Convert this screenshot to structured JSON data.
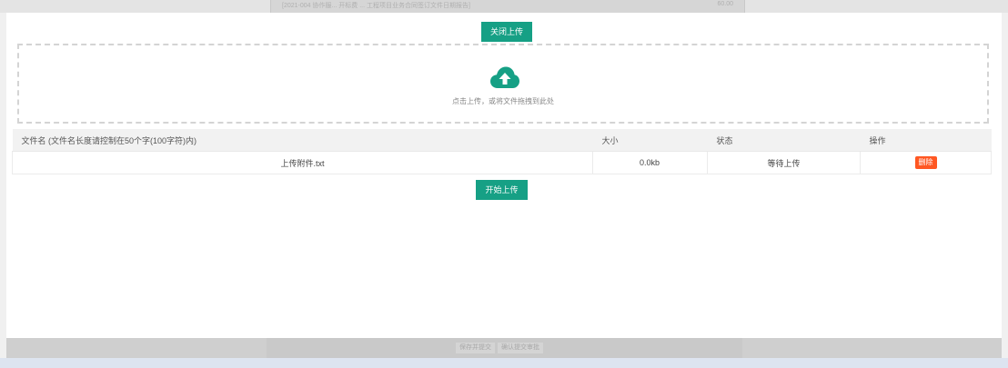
{
  "background": {
    "top_line_text": "[2021-004 协作服... 开标费 ... 工程项目业务合同签订文件日期报告]",
    "top_line_num": "60.00",
    "bottom_buttons": [
      "保存并提交",
      "确认提交审批"
    ]
  },
  "upload": {
    "close_label": "关闭上传",
    "dropzone_hint": "点击上传，或将文件拖拽到此处",
    "start_label": "开始上传"
  },
  "table": {
    "columns": [
      "文件名 (文件名长度请控制在50个字(100字符)内)",
      "大小",
      "状态",
      "操作"
    ],
    "rows": [
      {
        "name": "上传附件.txt",
        "size": "0.0kb",
        "status": "等待上传",
        "action": "删除"
      }
    ]
  },
  "colors": {
    "primary": "#16a085",
    "danger": "#ff5722"
  },
  "icons": {
    "dropzone": "cloud-upload-icon"
  }
}
